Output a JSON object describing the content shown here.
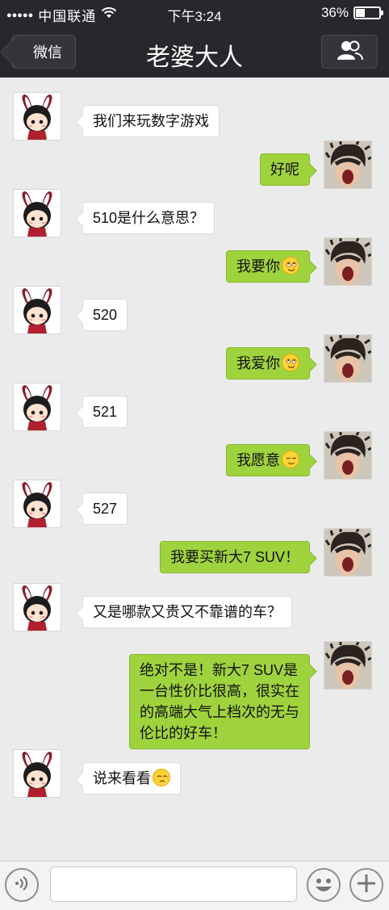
{
  "status_bar": {
    "signal_dots": "●●●●●",
    "carrier": "中国联通",
    "time": "下午3:24",
    "battery": "36%",
    "battery_level": 0.36
  },
  "nav": {
    "back_label": "微信",
    "title": "老婆大人"
  },
  "messages": [
    {
      "side": "left",
      "text": "我们来玩数字游戏"
    },
    {
      "side": "right",
      "text": "好呢"
    },
    {
      "side": "left",
      "text": "510是什么意思？"
    },
    {
      "side": "right",
      "text": "我要你",
      "emoji": "smile-eyes-up-emoji"
    },
    {
      "side": "left",
      "text": "520"
    },
    {
      "side": "right",
      "text": "我爱你",
      "emoji": "smile-eyes-up-emoji"
    },
    {
      "side": "left",
      "text": "521"
    },
    {
      "side": "right",
      "text": "我愿意",
      "emoji": "content-smile-emoji"
    },
    {
      "side": "left",
      "text": "527"
    },
    {
      "side": "right",
      "text": "我要买新大7 SUV！"
    },
    {
      "side": "left",
      "text": "又是哪款又贵又不靠谱的车？"
    },
    {
      "side": "right",
      "text": "绝对不是！新大7 SUV是\n一台性价比很高，很实在\n的高端大气上档次的无与\n伦比的好车！"
    },
    {
      "side": "left",
      "text": "说来看看",
      "emoji": "relieved-emoji"
    }
  ],
  "input_bar": {
    "placeholder": ""
  },
  "colors": {
    "header": "#27282c",
    "bubble_out": "#9fd33e",
    "bubble_in": "#ffffff",
    "chat_bg": "#ebebeb"
  }
}
